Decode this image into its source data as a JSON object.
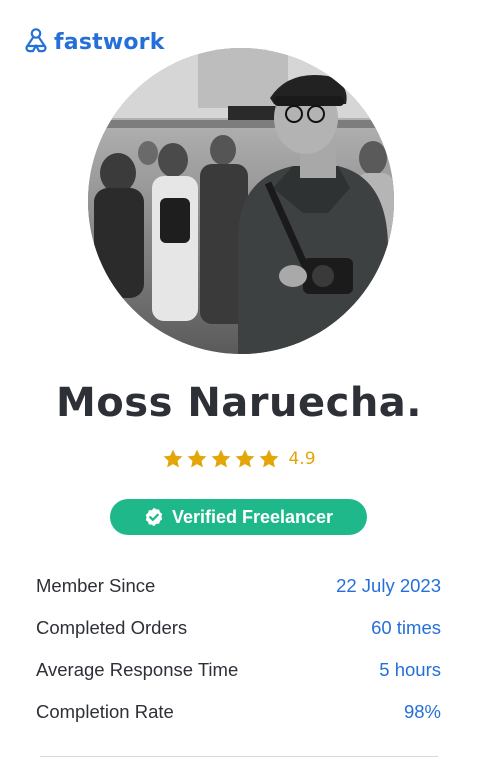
{
  "logo": {
    "text": "fastwork"
  },
  "profile": {
    "name": "Moss Naruecha.",
    "rating": "4.9",
    "rating_stars": 5,
    "badge": "Verified Freelancer"
  },
  "stats": [
    {
      "label": "Member Since",
      "value": "22 July 2023"
    },
    {
      "label": "Completed Orders",
      "value": "60 times"
    },
    {
      "label": "Average Response Time",
      "value": "5 hours"
    },
    {
      "label": "Completion Rate",
      "value": "98%"
    }
  ],
  "colors": {
    "brand": "#2570d8",
    "star": "#e3a608",
    "badge": "#1fb88a",
    "text": "#2d3036"
  },
  "icons": {
    "logo": "fastwork-logo-icon",
    "star": "star-icon",
    "verified": "check-circle-icon"
  }
}
